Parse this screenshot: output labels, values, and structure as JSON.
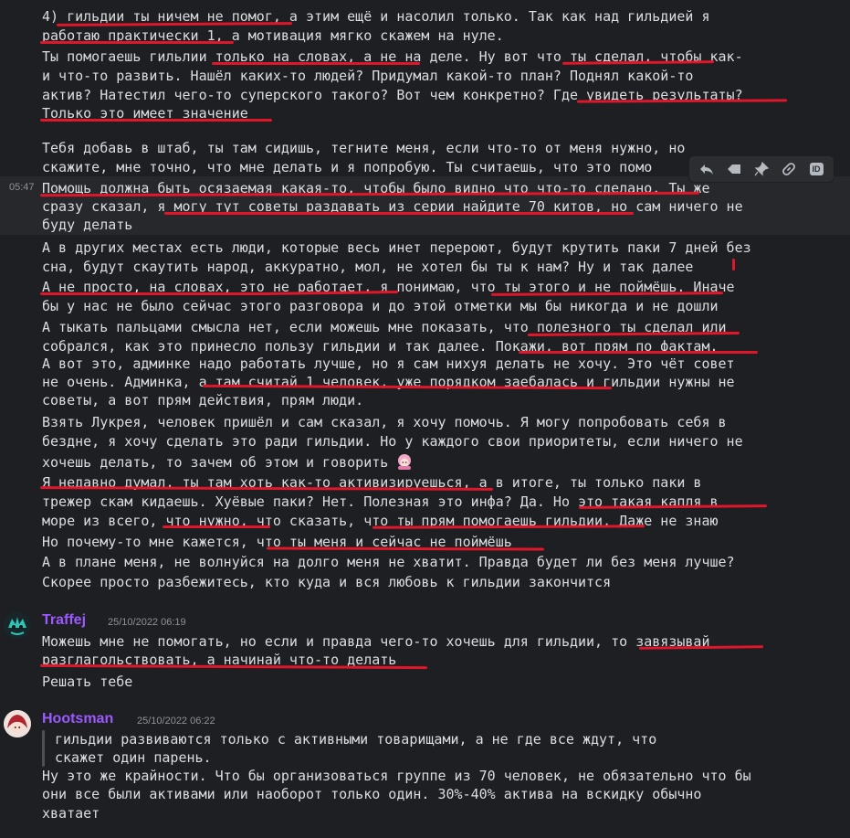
{
  "colors": {
    "background": "#1e1f22",
    "text": "#dcdde1",
    "username": "#9b59ff",
    "annotation": "#e0162b",
    "timestamp": "#8e9297"
  },
  "message1": {
    "lines": [
      "4) гильдии ты ничем не помог, а этим ещё и насолил только. Так как над гильдией я",
      "работаю практически 1, а мотивация мягко скажем на нуле.",
      "Ты помогаешь гильлии только на словах, а не на деле. Ну вот что ты сделал, чтобы как-",
      "и что-то развить. Нашёл каких-то людей? Придумал какой-то план? Поднял какой-то",
      "актив? Натестил чего-то суперского такого? Вот чем конкретно? Где увидеть результаты?",
      "Только это имеет значение",
      "Тебя добавь в штаб, ты там сидишь, тегните меня, если что-то от меня нужно, но",
      "скажите, мне точно, что мне делать и я попробую. Ты считаешь, что это помо"
    ],
    "hover_time": "05:47",
    "hover_lines": [
      "Помощь должна быть осязаемая какая-то, чтобы было видно что что-то сделано. Ты же",
      "сразу сказал, я могу тут советы раздавать из серии найдите 70 китов, но сам ничего не",
      "буду делать"
    ],
    "more_lines": [
      "А в других местах есть люди, которые весь инет перероют, будут крутить паки 7 дней без",
      "сна, будут скаутить народ, аккуратно, мол, не хотел бы ты к нам? Ну и так далее",
      "А не просто, на словах, это не работает, я понимаю, что ты этого и не поймёшь. Иначе",
      "бы у нас не было сейчас этого разговора и до этой отметки мы бы никогда и не дошли",
      "А тыкать пальцами смысла нет, если можешь мне показать, что полезного ты сделал или",
      "собрался, как это принесло пользу гильдии и так далее. Покажи, вот прям по фактам.",
      "А вот это, админке надо работать лучше, но я сам нихуя делать не хочу. Это чёт совет",
      "не очень. Админка, а там считай 1 человек, уже порядком заебалась и гильдии нужны не",
      "советы, а вот прям действия, прям люди.",
      "Взять Лукрея, человек пришёл и сам сказал, я хочу помочь. Я могу попробовать себя в",
      "бездне, я хочу сделать это ради гильдии. Но у каждого свои приоритеты, если ничего не",
      "хочешь делать, то зачем об этом и говорить",
      "Я недавно думал, ты там хоть как-то активизируешься, а в итоге, ты только паки в",
      "трежер скам кидаешь. Хуёвые паки? Нет. Полезная это инфа? Да. Но это такая капля в",
      "море из всего, что нужно, что сказать, что ты прям помогаешь гильдии. Даже не знаю",
      "Но почему-то мне кажется, что ты меня и сейчас не поймёшь",
      "А в плане меня, не волнуйся на долго меня не хватит. Правда будет ли без меня лучше?",
      "Скорее просто разбежитесь, кто куда и вся любовь к гильдии закончится"
    ]
  },
  "message2": {
    "author": "Traffej",
    "time": "25/10/2022 06:19",
    "lines": [
      "Можешь мне не помогать, но если и правда чего-то хочешь для гильдии, то завязывай",
      "разглагольствовать, а начинай что-то делать",
      "Решать тебе"
    ]
  },
  "message3": {
    "author": "Hootsman",
    "time": "25/10/2022 06:22",
    "quote_lines": [
      "гильдии развиваются только с активными товарищами, а не где все ждут, что",
      "скажет один парень."
    ],
    "lines": [
      "Ну это же крайности. Что бы организоваться группе из 70 человек, не обязательно что бы",
      "они все были активами или наоборот только один. 30%-40% актива на вскидку обычно",
      "хватает"
    ]
  },
  "toolbar": {
    "reply_icon": "reply-icon",
    "tag_icon": "tag-icon",
    "pin_icon": "pin-icon",
    "link_icon": "link-icon",
    "id_label": "ID"
  }
}
